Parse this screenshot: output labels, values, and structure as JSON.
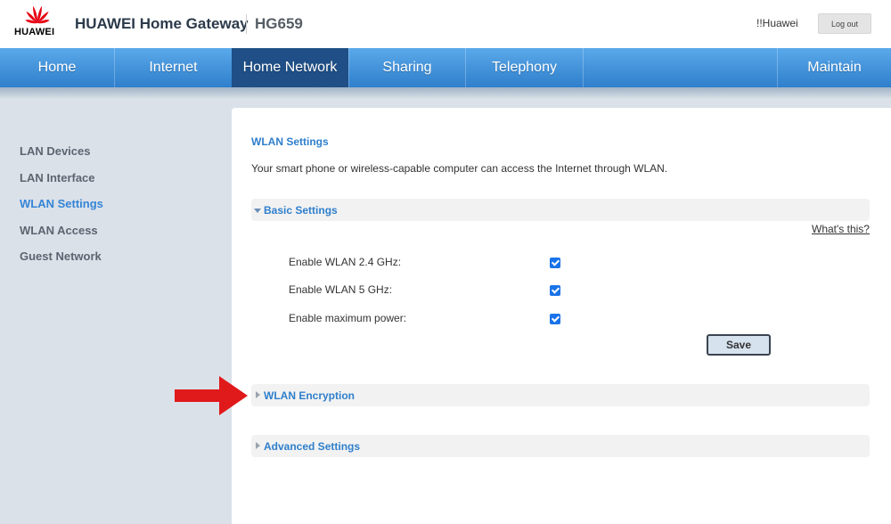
{
  "header": {
    "brand": "HUAWEI",
    "app_title": "HUAWEI Home Gateway",
    "model": "HG659",
    "user": "!!Huawei",
    "logout_label": "Log out"
  },
  "nav": {
    "items": [
      {
        "label": "Home"
      },
      {
        "label": "Internet"
      },
      {
        "label": "Home Network",
        "active": true
      },
      {
        "label": "Sharing"
      },
      {
        "label": "Telephony"
      },
      {
        "label": "Maintain"
      }
    ]
  },
  "sidebar": {
    "items": [
      {
        "label": "LAN Devices"
      },
      {
        "label": "LAN Interface"
      },
      {
        "label": "WLAN Settings",
        "active": true
      },
      {
        "label": "WLAN Access"
      },
      {
        "label": "Guest Network"
      }
    ]
  },
  "main": {
    "title": "WLAN Settings",
    "description": "Your smart phone or wireless-capable computer can access the Internet through WLAN.",
    "basic_settings": {
      "label": "Basic Settings",
      "expanded": true,
      "whats_this": "What's this?",
      "rows": [
        {
          "label": "Enable WLAN 2.4 GHz:",
          "checked": true
        },
        {
          "label": "Enable WLAN 5 GHz:",
          "checked": true
        },
        {
          "label": "Enable maximum power:",
          "checked": true
        }
      ],
      "save_label": "Save"
    },
    "wlan_encryption": {
      "label": "WLAN Encryption",
      "expanded": false
    },
    "advanced_settings": {
      "label": "Advanced Settings",
      "expanded": false
    }
  },
  "colors": {
    "accent": "#2f7fcc",
    "nav_active": "#1f4f86",
    "sidebar_bg": "#dbe1e9",
    "annotation_arrow": "#e0191b",
    "brand_red": "#e60012"
  }
}
